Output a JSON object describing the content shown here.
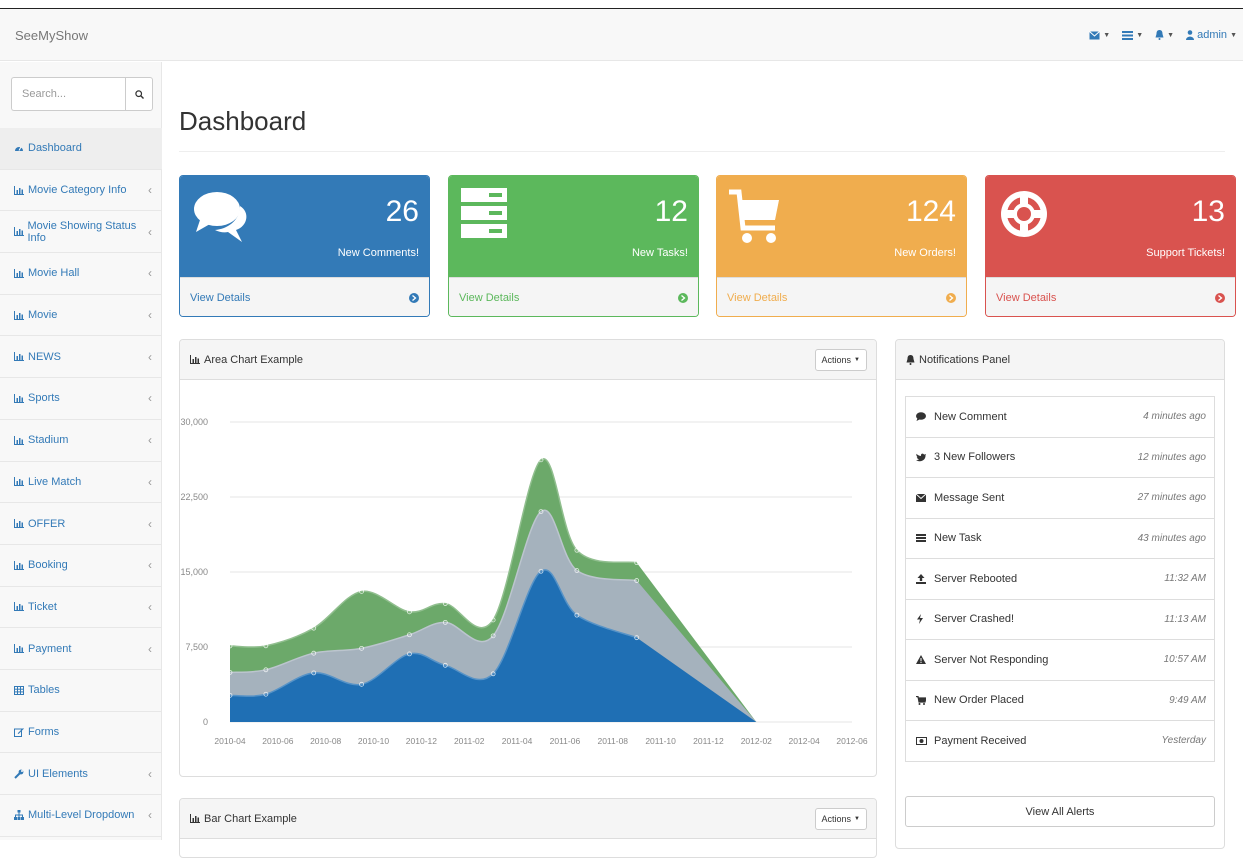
{
  "app": {
    "brand": "SeeMyShow"
  },
  "topnav": {
    "user_label": "admin"
  },
  "search": {
    "placeholder": "Search..."
  },
  "sidebar": {
    "items": [
      {
        "label": "Dashboard",
        "icon": "dashboard-icon",
        "has_children": false,
        "active": true
      },
      {
        "label": "Movie Category Info",
        "icon": "bar-chart-icon",
        "has_children": true
      },
      {
        "label": "Movie Showing Status Info",
        "icon": "bar-chart-icon",
        "has_children": true
      },
      {
        "label": "Movie Hall",
        "icon": "bar-chart-icon",
        "has_children": true
      },
      {
        "label": "Movie",
        "icon": "bar-chart-icon",
        "has_children": true
      },
      {
        "label": "NEWS",
        "icon": "bar-chart-icon",
        "has_children": true
      },
      {
        "label": "Sports",
        "icon": "bar-chart-icon",
        "has_children": true
      },
      {
        "label": "Stadium",
        "icon": "bar-chart-icon",
        "has_children": true
      },
      {
        "label": "Live Match",
        "icon": "bar-chart-icon",
        "has_children": true
      },
      {
        "label": "OFFER",
        "icon": "bar-chart-icon",
        "has_children": true
      },
      {
        "label": "Booking",
        "icon": "bar-chart-icon",
        "has_children": true
      },
      {
        "label": "Ticket",
        "icon": "bar-chart-icon",
        "has_children": true
      },
      {
        "label": "Payment",
        "icon": "bar-chart-icon",
        "has_children": true
      },
      {
        "label": "Tables",
        "icon": "table-icon",
        "has_children": false
      },
      {
        "label": "Forms",
        "icon": "edit-icon",
        "has_children": false
      },
      {
        "label": "UI Elements",
        "icon": "wrench-icon",
        "has_children": true
      },
      {
        "label": "Multi-Level Dropdown",
        "icon": "sitemap-icon",
        "has_children": true
      }
    ]
  },
  "page": {
    "title": "Dashboard"
  },
  "stats": [
    {
      "value": "26",
      "label": "New Comments!",
      "footer": "View Details",
      "color": "#337ab7",
      "icon": "comments-icon"
    },
    {
      "value": "12",
      "label": "New Tasks!",
      "footer": "View Details",
      "color": "#5cb85c",
      "icon": "tasks-icon"
    },
    {
      "value": "124",
      "label": "New Orders!",
      "footer": "View Details",
      "color": "#f0ad4e",
      "icon": "shopping-cart-icon"
    },
    {
      "value": "13",
      "label": "Support Tickets!",
      "footer": "View Details",
      "color": "#d9534f",
      "icon": "support-icon"
    }
  ],
  "area_panel": {
    "title": "Area Chart Example",
    "actions_label": "Actions"
  },
  "bar_panel": {
    "title": "Bar Chart Example",
    "actions_label": "Actions"
  },
  "notifications": {
    "title": "Notifications Panel",
    "items": [
      {
        "label": "New Comment",
        "time": "4 minutes ago",
        "icon": "comment-icon"
      },
      {
        "label": "3 New Followers",
        "time": "12 minutes ago",
        "icon": "twitter-icon"
      },
      {
        "label": "Message Sent",
        "time": "27 minutes ago",
        "icon": "envelope-icon"
      },
      {
        "label": "New Task",
        "time": "43 minutes ago",
        "icon": "tasks-icon"
      },
      {
        "label": "Server Rebooted",
        "time": "11:32 AM",
        "icon": "upload-icon"
      },
      {
        "label": "Server Crashed!",
        "time": "11:13 AM",
        "icon": "bolt-icon"
      },
      {
        "label": "Server Not Responding",
        "time": "10:57 AM",
        "icon": "warning-icon"
      },
      {
        "label": "New Order Placed",
        "time": "9:49 AM",
        "icon": "shopping-cart-icon"
      },
      {
        "label": "Payment Received",
        "time": "Yesterday",
        "icon": "money-icon"
      }
    ],
    "view_all_label": "View All Alerts"
  },
  "chart_data": {
    "type": "area",
    "stacked": true,
    "categories": [
      "2010-04",
      "2010-06",
      "2010-08",
      "2010-10",
      "2010-12",
      "2011-02",
      "2011-04",
      "2011-06",
      "2011-08",
      "2011-10",
      "2011-12",
      "2012-02",
      "2012-04",
      "2012-06"
    ],
    "yticks": [
      "0",
      "7,500",
      "15,000",
      "22,500",
      "30,000"
    ],
    "ylim": [
      0,
      30000
    ],
    "grid": true,
    "points_x": [
      0,
      1.5,
      3.5,
      5.5,
      7.5,
      9.0,
      11.0,
      13.0,
      14.5,
      17.0,
      18.5,
      20.0,
      22.0
    ],
    "series": [
      {
        "color": "#1f6fb4",
        "values": [
          2666,
          2778,
          4912,
          3767,
          6810,
          5670,
          4820,
          15073,
          10687,
          8432
        ]
      },
      {
        "color": "#a5b2bd",
        "values": [
          2294,
          2441,
          1969,
          3597,
          1914,
          4293,
          3795,
          5967,
          4460,
          5713
        ]
      },
      {
        "color": "#6ca96a",
        "values": [
          2647,
          2401,
          2501,
          5689,
          2293,
          1881,
          1588,
          5175,
          2028,
          1791
        ]
      }
    ]
  }
}
